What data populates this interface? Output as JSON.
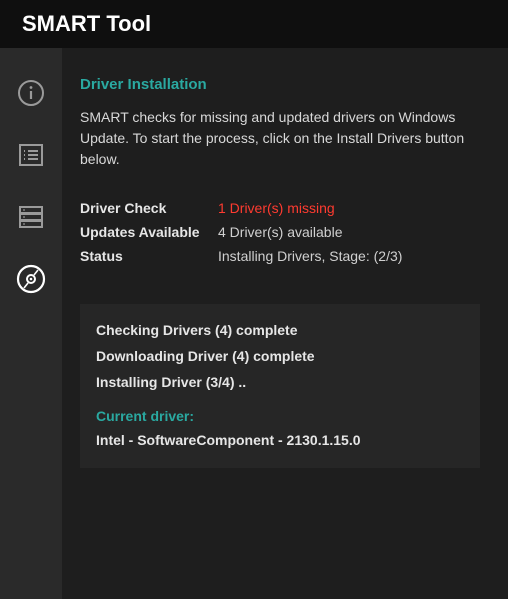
{
  "title": "SMART Tool",
  "sidebar": {
    "items": [
      {
        "name": "info"
      },
      {
        "name": "list"
      },
      {
        "name": "storage"
      },
      {
        "name": "drivers"
      }
    ]
  },
  "main": {
    "section_title": "Driver Installation",
    "description": "SMART checks for missing and updated drivers on Windows Update. To start the process, click on the Install Drivers button below.",
    "status": {
      "driver_check_label": "Driver Check",
      "driver_check_value": "1 Driver(s) missing",
      "updates_label": "Updates Available",
      "updates_value": "4 Driver(s) available",
      "status_label": "Status",
      "status_value": "Installing Drivers, Stage: (2/3)"
    },
    "progress": {
      "line1": "Checking Drivers (4) complete",
      "line2": "Downloading Driver (4) complete",
      "line3": "Installing Driver (3/4) ..",
      "current_label": "Current driver:",
      "current_value": "Intel - SoftwareComponent - 2130.1.15.0"
    }
  }
}
